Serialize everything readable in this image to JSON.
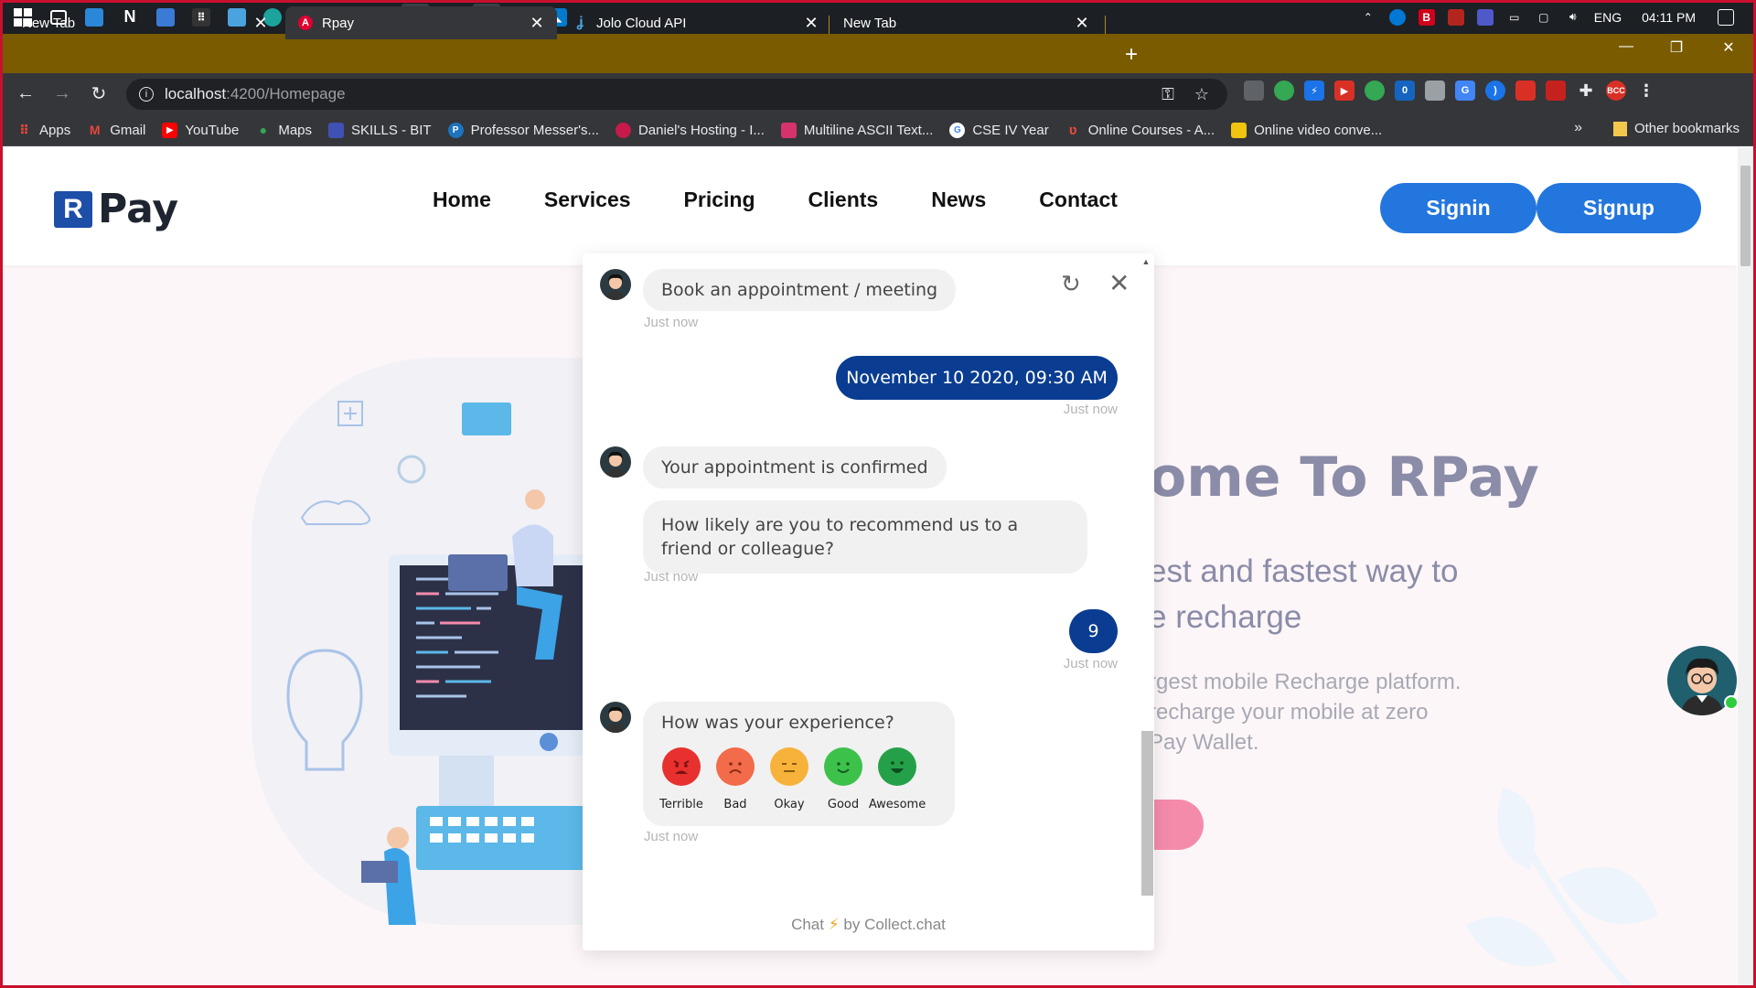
{
  "taskbar": {
    "language": "ENG",
    "time": "04:11 PM",
    "badges": [
      "B",
      "T",
      "Ps"
    ]
  },
  "tabs": [
    {
      "title": "New Tab",
      "active": false
    },
    {
      "title": "Rpay",
      "active": true
    },
    {
      "title": "Jolo Cloud API",
      "active": false
    },
    {
      "title": "New Tab",
      "active": false
    }
  ],
  "omnibox": {
    "host": "localhost",
    "path": ":4200/Homepage"
  },
  "extensions": {
    "avatar_text": "BCC",
    "badge": "0"
  },
  "bookmarks": [
    {
      "label": "Apps",
      "icon": "apps-grid-icon",
      "color": "#e8453c"
    },
    {
      "label": "Gmail",
      "icon": "gmail-icon",
      "color": "#e8453c"
    },
    {
      "label": "YouTube",
      "icon": "youtube-icon",
      "color": "#ff0000"
    },
    {
      "label": "Maps",
      "icon": "maps-icon",
      "color": "#34a853"
    },
    {
      "label": "SKILLS - BIT",
      "icon": "skills-icon",
      "color": "#3f51b5"
    },
    {
      "label": "Professor Messer's...",
      "icon": "messer-icon",
      "color": "#1e73be"
    },
    {
      "label": "Daniel's Hosting - I...",
      "icon": "raspberry-icon",
      "color": "#c51a4a"
    },
    {
      "label": "Multiline ASCII Text...",
      "icon": "bow-icon",
      "color": "#d6336c"
    },
    {
      "label": "CSE IV Year",
      "icon": "google-icon",
      "color": "#4285f4"
    },
    {
      "label": "Online Courses - A...",
      "icon": "courses-icon",
      "color": "#c0392b"
    },
    {
      "label": "Online video conve...",
      "icon": "video-convert-icon",
      "color": "#f1c40f"
    }
  ],
  "other_bookmarks": "Other bookmarks",
  "site": {
    "logo_mark": "R",
    "logo_text": "Pay",
    "nav": [
      "Home",
      "Services",
      "Pricing",
      "Clients",
      "News",
      "Contact"
    ],
    "signin": "Signin",
    "signup": "Signup"
  },
  "hero": {
    "title": "ome To RPay",
    "sub1": "est and fastest way to",
    "sub2": "e recharge",
    "p1": "rgest mobile Recharge platform.",
    "p2": "recharge your mobile at zero",
    "p3": "Pay Wallet."
  },
  "chat": {
    "messages": [
      {
        "from": "bot",
        "text": "Book an appointment / meeting",
        "time": "Just now"
      },
      {
        "from": "user",
        "text": "November 10 2020, 09:30 AM",
        "time": "Just now"
      },
      {
        "from": "bot",
        "text": "Your appointment is confirmed"
      },
      {
        "from": "bot",
        "text": "How likely are you to recommend us to a friend or colleague?",
        "time": "Just now"
      },
      {
        "from": "user",
        "text": "9",
        "time": "Just now"
      },
      {
        "from": "bot",
        "text": "How was your experience?",
        "time": "Just now"
      }
    ],
    "ratings": [
      {
        "label": "Terrible",
        "color": "#e8312f"
      },
      {
        "label": "Bad",
        "color": "#f26b4a"
      },
      {
        "label": "Okay",
        "color": "#f7b23b"
      },
      {
        "label": "Good",
        "color": "#3cc24b"
      },
      {
        "label": "Awesome",
        "color": "#24a148"
      }
    ],
    "footer_prefix": "Chat",
    "footer_suffix": "by Collect.chat"
  }
}
